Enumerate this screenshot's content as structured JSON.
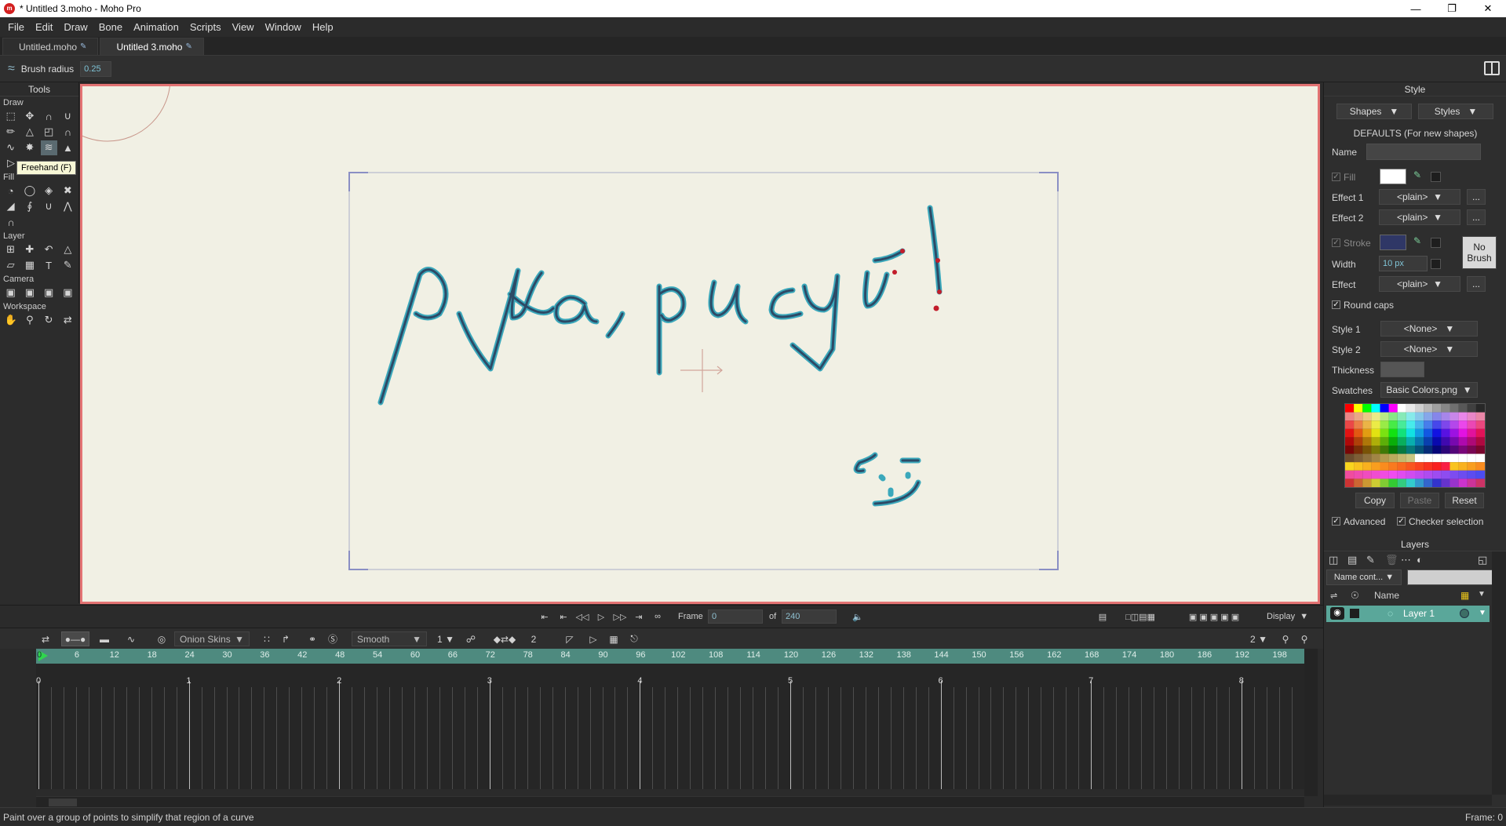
{
  "window": {
    "title": "* Untitled 3.moho - Moho Pro",
    "app_icon": "moho-logo-icon",
    "controls": [
      "minimize-icon",
      "maximize-icon",
      "close-icon"
    ]
  },
  "menu": [
    "File",
    "Edit",
    "Draw",
    "Bone",
    "Animation",
    "Scripts",
    "View",
    "Window",
    "Help"
  ],
  "doc_tabs": [
    {
      "label": "Untitled.moho",
      "active": false
    },
    {
      "label": "Untitled 3.moho",
      "active": true
    }
  ],
  "tool_options": {
    "brush_radius_label": "Brush radius",
    "brush_radius_value": "0.25"
  },
  "tools": {
    "title": "Tools",
    "sections": {
      "draw": "Draw",
      "fill": "Fill",
      "layer": "Layer",
      "camera": "Camera",
      "workspace": "Workspace"
    },
    "tooltip": "Freehand (F)"
  },
  "canvas": {
    "drawing_text": "рука, рисуй!",
    "background_color": "#f1f0e4",
    "border_color": "#e37373",
    "stroke_color": "#2d4a66",
    "point_color": "#45b8c9"
  },
  "playback": {
    "frame_label": "Frame",
    "frame_value": "0",
    "of_label": "of",
    "total_frames": "240",
    "display_label": "Display"
  },
  "timeline": {
    "onion_skins": "Onion Skins",
    "interpolation": "Smooth",
    "interp_value": "1",
    "keys_value": "2",
    "zoom_value": "2",
    "frame_ticks": [
      "0",
      "6",
      "12",
      "18",
      "24",
      "30",
      "36",
      "42",
      "48",
      "54",
      "60",
      "66",
      "72",
      "78",
      "84",
      "90",
      "96",
      "102",
      "108",
      "114",
      "120",
      "126",
      "132",
      "138",
      "144",
      "150",
      "156",
      "162",
      "168",
      "174",
      "180",
      "186",
      "192",
      "198"
    ],
    "second_ticks": [
      "0",
      "1",
      "2",
      "3",
      "4",
      "5",
      "6",
      "7",
      "8"
    ]
  },
  "style": {
    "title": "Style",
    "shapes_label": "Shapes",
    "styles_label": "Styles",
    "defaults_label": "DEFAULTS (For new shapes)",
    "name_label": "Name",
    "fill_label": "Fill",
    "effect1_label": "Effect 1",
    "effect1_value": "<plain>",
    "effect2_label": "Effect 2",
    "effect2_value": "<plain>",
    "more_label": "...",
    "stroke_label": "Stroke",
    "no_brush_label": "No Brush",
    "width_label": "Width",
    "width_value": "10 px",
    "effect_label": "Effect",
    "effect_value": "<plain>",
    "round_caps_label": "Round caps",
    "style1_label": "Style 1",
    "style1_value": "<None>",
    "style2_label": "Style 2",
    "style2_value": "<None>",
    "thickness_label": "Thickness",
    "swatches_label": "Swatches",
    "swatches_value": "Basic Colors.png",
    "copy_label": "Copy",
    "paste_label": "Paste",
    "reset_label": "Reset",
    "advanced_label": "Advanced",
    "checker_label": "Checker selection",
    "fill_color": "#ffffff",
    "stroke_color": "#2f3766"
  },
  "layers": {
    "title": "Layers",
    "filter_label": "Name cont...",
    "name_header": "Name",
    "items": [
      {
        "name": "Layer 1",
        "selected": true
      }
    ]
  },
  "status": {
    "message": "Paint over a group of points to simplify that region of a curve",
    "frame": "Frame: 0"
  }
}
